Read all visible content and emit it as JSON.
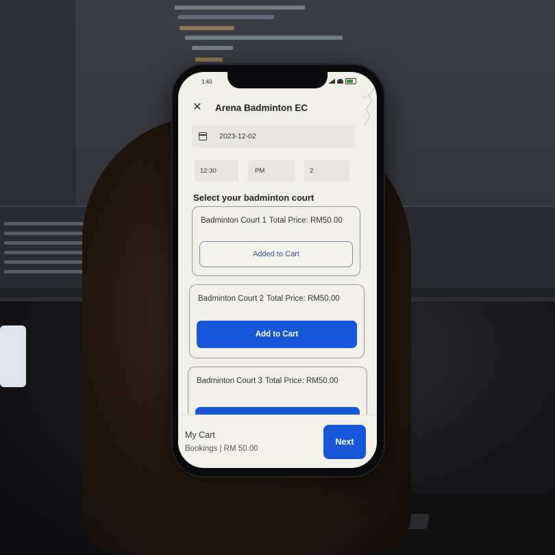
{
  "status_bar": {
    "time": "1:40"
  },
  "app": {
    "title": "Arena Badminton EC",
    "close_icon": "close-icon"
  },
  "form": {
    "date": "2023-12-02",
    "time": "12:30",
    "ampm": "PM",
    "duration": "2"
  },
  "section_title": "Select your badminton court",
  "courts": [
    {
      "name": "Badminton Court 1",
      "price_label": "Total Price: RM50.00",
      "button_label": "Added to Cart",
      "state": "added"
    },
    {
      "name": "Badminton Court 2",
      "price_label": "Total Price: RM50.00",
      "button_label": "Add to Cart",
      "state": "available"
    },
    {
      "name": "Badminton Court 3",
      "price_label": "Total Price: RM50.00",
      "button_label": "",
      "state": "available"
    }
  ],
  "cart": {
    "title": "My Cart",
    "summary": "Bookings | RM 50.00",
    "next_label": "Next"
  },
  "colors": {
    "primary": "#1557d8",
    "screen_bg": "#f1f0e8",
    "field_bg": "#e6e5de"
  }
}
